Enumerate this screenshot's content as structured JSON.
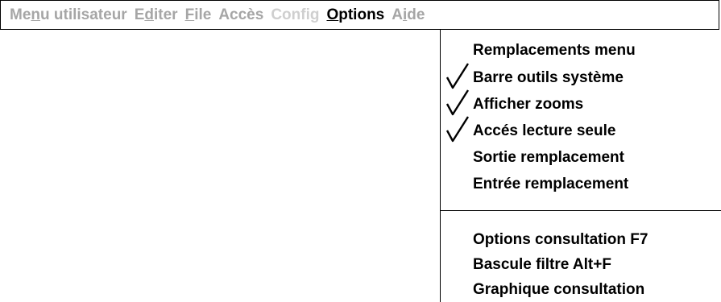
{
  "menubar": {
    "items": [
      {
        "pre": "Me",
        "mn": "n",
        "post": "u utilisateur",
        "state": "disabled"
      },
      {
        "pre": "E",
        "mn": "d",
        "post": "iter",
        "state": "disabled"
      },
      {
        "pre": "",
        "mn": "F",
        "post": "ile",
        "state": "disabled"
      },
      {
        "pre": "Accès",
        "mn": "",
        "post": "",
        "state": "disabled"
      },
      {
        "pre": "Config",
        "mn": "",
        "post": "",
        "state": "disabled-faint"
      },
      {
        "pre": "",
        "mn": "O",
        "post": "ptions",
        "state": "active"
      },
      {
        "pre": "A",
        "mn": "i",
        "post": "de",
        "state": "disabled"
      }
    ]
  },
  "options_menu": {
    "group1": [
      {
        "label": "Remplacements menu",
        "checked": false
      },
      {
        "label": "Barre outils système",
        "checked": true
      },
      {
        "label": "Afficher zooms",
        "checked": true
      },
      {
        "label": "Accés lecture seule",
        "checked": true
      },
      {
        "label": "Sortie remplacement",
        "checked": false
      },
      {
        "label": "Entrée remplacement",
        "checked": false
      }
    ],
    "group2": [
      {
        "label": "Options consultation F7",
        "checked": false
      },
      {
        "label": "Bascule filtre Alt+F",
        "checked": false
      },
      {
        "label": "Graphique consultation",
        "checked": false
      }
    ]
  }
}
